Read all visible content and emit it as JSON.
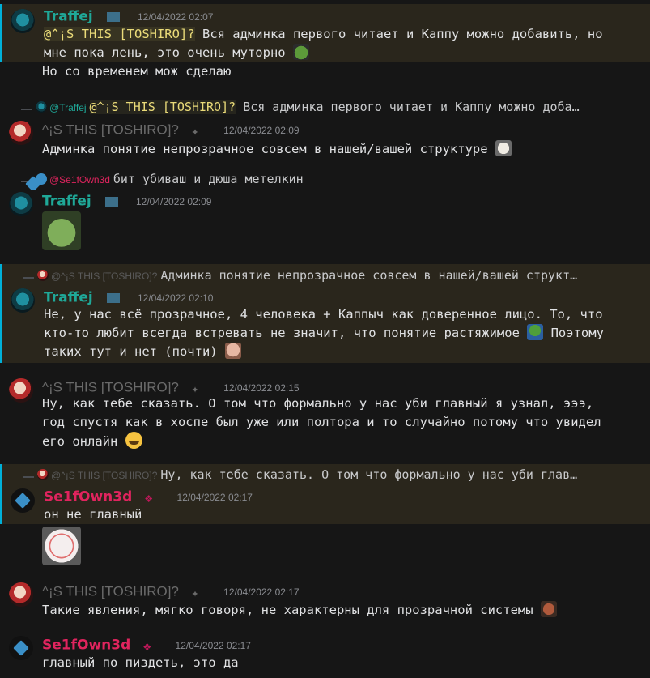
{
  "messages": [
    {
      "author": "Traffej",
      "timestamp": "12/04/2022 02:07",
      "mention": "@^¡S THIS [TOSHIRO]?",
      "text_lines": [
        "Вся админка первого читает и Каппу можно добавить, но",
        "мне пока лень, это очень муторно"
      ],
      "text_line3": "Но со временем мож сделаю"
    },
    {
      "reply_author": "@Traffej",
      "reply_mention": "@^¡S THIS [TOSHIRO]?",
      "reply_text": "Вся админка первого читает и Каппу можно доба…",
      "author": "^¡S THIS [TOSHIRO]?",
      "timestamp": "12/04/2022 02:09",
      "text": "Админка понятие непрозрачное совсем в нашей/вашей структуре"
    },
    {
      "reply_author": "@Se1fOwn3d",
      "reply_text": "бит убиваш и дюша метелкин",
      "author": "Traffej",
      "timestamp": "12/04/2022 02:09"
    },
    {
      "reply_author": "@^¡S THIS [TOSHIRO]?",
      "reply_text": "Админка понятие непрозрачное совсем в нашей/вашей структ…",
      "author": "Traffej",
      "timestamp": "12/04/2022 02:10",
      "text_lines": [
        "Не, у нас всё прозрачное, 4 человека + Каппыч как доверенное лицо. То, что",
        "кто-то любит всегда встревать не значит, что понятие растяжимое",
        "Поэтому",
        "таких тут и нет (почти)"
      ]
    },
    {
      "author": "^¡S THIS [TOSHIRO]?",
      "timestamp": "12/04/2022 02:15",
      "text_lines": [
        "Ну, как тебе сказать. О том что формально у нас уби главный я узнал, эээ,",
        "год спустя как в хоспе был уже или полтора и то случайно потому что увидел",
        "его онлайн"
      ]
    },
    {
      "reply_author": "@^¡S THIS [TOSHIRO]?",
      "reply_text": "Ну, как тебе сказать. О том что формально у нас уби глав…",
      "author": "Se1fOwn3d",
      "timestamp": "12/04/2022 02:17",
      "text": "он не главный"
    },
    {
      "author": "^¡S THIS [TOSHIRO]?",
      "timestamp": "12/04/2022 02:17",
      "text": "Такие явления, мягко говоря, не характерны для прозрачной системы"
    },
    {
      "author": "Se1fOwn3d",
      "timestamp": "12/04/2022 02:17",
      "text": "главный по пиздеть, это да"
    }
  ],
  "colors": {
    "accent": "#00b0d8",
    "traffej": "#1fa898",
    "self": "#e0245e",
    "mention": "#eadb79",
    "highlight_bg": "#2a261c"
  }
}
